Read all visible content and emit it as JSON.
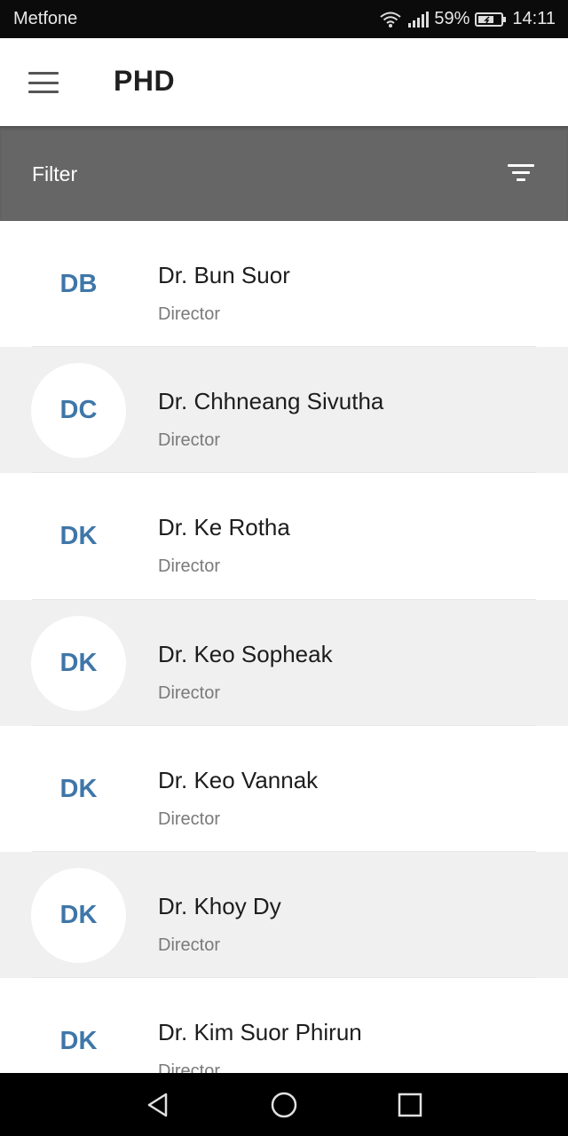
{
  "status_bar": {
    "carrier": "Metfone",
    "battery": "59%",
    "time": "14:11",
    "icons": [
      "wifi-icon",
      "signal-icon",
      "battery-icon"
    ]
  },
  "app_bar": {
    "title": "PHD",
    "menu_icon": "hamburger-menu-icon"
  },
  "filter_bar": {
    "label": "Filter",
    "icon": "filter-icon"
  },
  "directors": [
    {
      "initials": "DB",
      "name": "Dr. Bun Suor",
      "role": "Director"
    },
    {
      "initials": "DC",
      "name": "Dr. Chhneang Sivutha",
      "role": "Director"
    },
    {
      "initials": "DK",
      "name": "Dr. Ke Rotha",
      "role": "Director"
    },
    {
      "initials": "DK",
      "name": "Dr. Keo Sopheak",
      "role": "Director"
    },
    {
      "initials": "DK",
      "name": "Dr. Keo Vannak",
      "role": "Director"
    },
    {
      "initials": "DK",
      "name": "Dr. Khoy Dy",
      "role": "Director"
    },
    {
      "initials": "DK",
      "name": "Dr. Kim Suor Phirun",
      "role": "Director"
    }
  ],
  "nav_bar": {
    "buttons": [
      "back-icon",
      "home-icon",
      "recents-icon"
    ]
  },
  "colors": {
    "accent_initials": "#3f76a8",
    "filter_bar_bg": "#666666",
    "shaded_row_bg": "#f0f0f0"
  }
}
